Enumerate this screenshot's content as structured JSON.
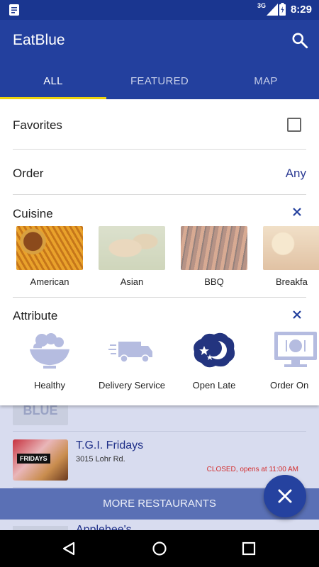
{
  "status_bar": {
    "time": "8:29",
    "network": "3G"
  },
  "app": {
    "title": "EatBlue"
  },
  "tabs": [
    {
      "label": "ALL",
      "active": true
    },
    {
      "label": "FEATURED",
      "active": false
    },
    {
      "label": "MAP",
      "active": false
    }
  ],
  "colors": {
    "primary": "#23409e",
    "accent": "#f1d60e",
    "closed": "#d32f2f"
  },
  "filters": {
    "favorites_label": "Favorites",
    "order_label": "Order",
    "order_value": "Any",
    "cuisine_label": "Cuisine",
    "cuisines": [
      {
        "label": "American",
        "selected": true
      },
      {
        "label": "Asian",
        "selected": false
      },
      {
        "label": "BBQ",
        "selected": false
      },
      {
        "label": "Breakfa",
        "selected": false
      }
    ],
    "attribute_label": "Attribute",
    "attributes": [
      {
        "label": "Healthy",
        "icon": "fruit-bowl-icon",
        "selected": false
      },
      {
        "label": "Delivery Service",
        "icon": "delivery-truck-icon",
        "selected": false
      },
      {
        "label": "Open Late",
        "icon": "moon-stars-icon",
        "selected": true
      },
      {
        "label": "Order On",
        "icon": "computer-order-icon",
        "selected": false
      }
    ]
  },
  "restaurants": [
    {
      "name": "T.G.I. Fridays",
      "address": "3015 Lohr Rd.",
      "status": "CLOSED, opens at 11:00 AM",
      "logo_text": "FRIDAYS"
    },
    {
      "name": "Applebee's"
    }
  ],
  "more_restaurants_label": "MORE RESTAURANTS"
}
